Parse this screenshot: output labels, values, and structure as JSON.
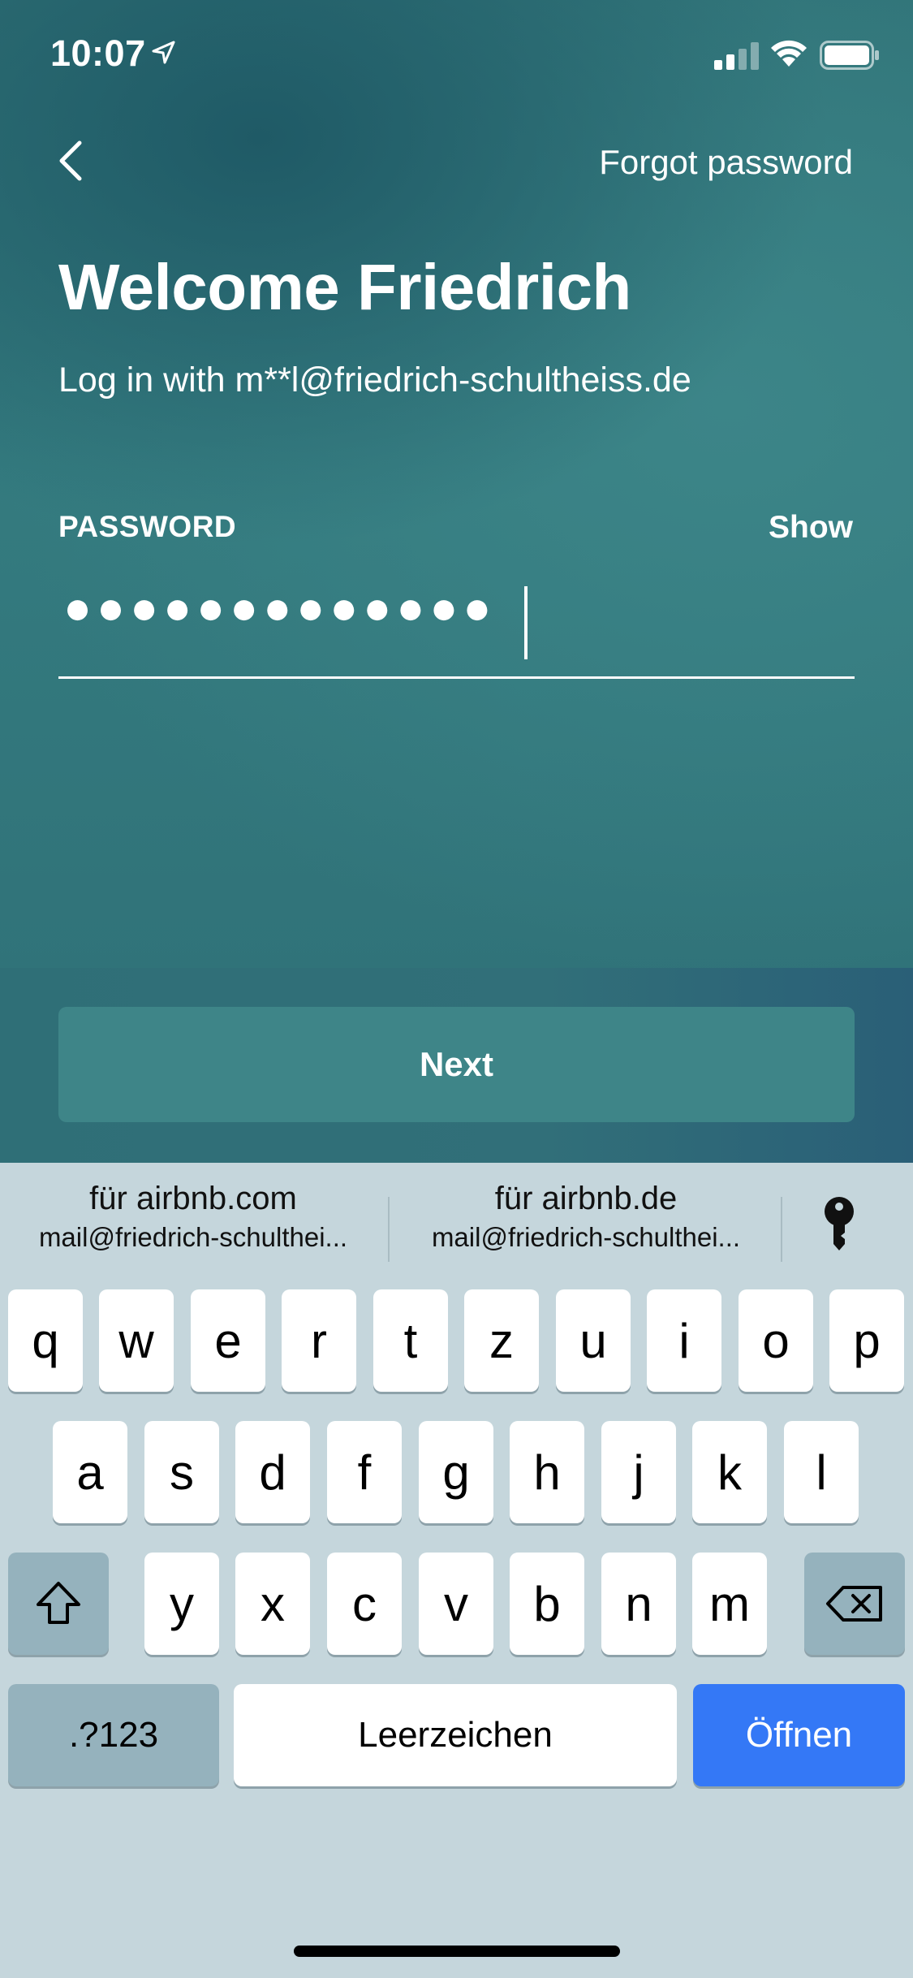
{
  "status_bar": {
    "time": "10:07"
  },
  "nav": {
    "forgot_label": "Forgot password"
  },
  "header": {
    "title": "Welcome Friedrich",
    "subtitle": "Log in with m**l@friedrich-schultheiss.de"
  },
  "password": {
    "label": "PASSWORD",
    "show_label": "Show",
    "masked_value": "●●●●●●●●●●●●●"
  },
  "actions": {
    "next_label": "Next"
  },
  "keyboard": {
    "suggestions": [
      {
        "title": "für airbnb.com",
        "account": "mail@friedrich-schulthei..."
      },
      {
        "title": "für airbnb.de",
        "account": "mail@friedrich-schulthei..."
      }
    ],
    "row1": [
      "q",
      "w",
      "e",
      "r",
      "t",
      "z",
      "u",
      "i",
      "o",
      "p"
    ],
    "row2": [
      "a",
      "s",
      "d",
      "f",
      "g",
      "h",
      "j",
      "k",
      "l"
    ],
    "row3": [
      "y",
      "x",
      "c",
      "v",
      "b",
      "n",
      "m"
    ],
    "numbers_label": ".?123",
    "space_label": "Leerzeichen",
    "return_label": "Öffnen"
  },
  "colors": {
    "accent_blue": "#3478f6",
    "button_teal": "#3e8588",
    "background_teal": "#347b7f"
  }
}
